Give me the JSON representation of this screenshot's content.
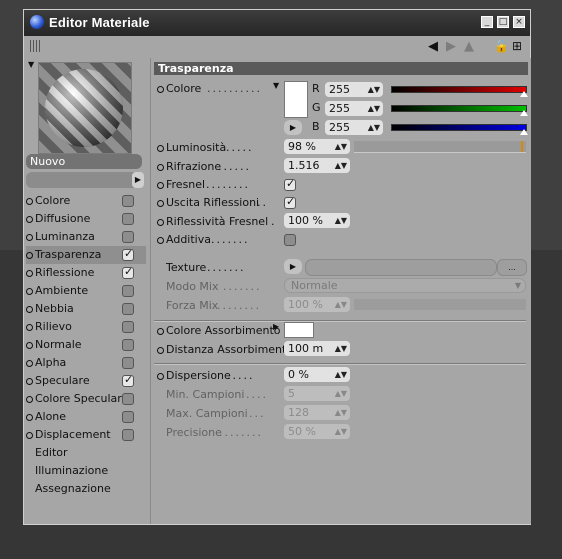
{
  "window": {
    "title": "Editor Materiale"
  },
  "preview": {
    "material_name": "Nuovo"
  },
  "channels": [
    {
      "label": "Colore",
      "checked": false
    },
    {
      "label": "Diffusione",
      "checked": false
    },
    {
      "label": "Luminanza",
      "checked": false
    },
    {
      "label": "Trasparenza",
      "checked": true
    },
    {
      "label": "Riflessione",
      "checked": true
    },
    {
      "label": "Ambiente",
      "checked": false
    },
    {
      "label": "Nebbia",
      "checked": false
    },
    {
      "label": "Rilievo",
      "checked": false
    },
    {
      "label": "Normale",
      "checked": false
    },
    {
      "label": "Alpha",
      "checked": false
    },
    {
      "label": "Speculare",
      "checked": true
    },
    {
      "label": "Colore Speculare",
      "checked": false
    },
    {
      "label": "Alone",
      "checked": false
    },
    {
      "label": "Displacement",
      "checked": false
    }
  ],
  "extra_pages": [
    "Editor",
    "Illuminazione",
    "Assegnazione"
  ],
  "section": {
    "title": "Trasparenza"
  },
  "color": {
    "label": "Colore",
    "r_label": "R",
    "g_label": "G",
    "b_label": "B",
    "r": "255",
    "g": "255",
    "b": "255",
    "swatch": "#ffffff"
  },
  "params": {
    "luminosita": {
      "label": "Luminosità",
      "value": "98 %",
      "fraction": 0.98
    },
    "rifrazione": {
      "label": "Rifrazione",
      "value": "1.516"
    },
    "fresnel": {
      "label": "Fresnel",
      "checked": true
    },
    "uscita_riflessioni": {
      "label": "Uscita Riflessioni",
      "checked": true
    },
    "riflessivita_fresnel": {
      "label": "Riflessività Fresnel",
      "value": "100 %"
    },
    "additiva": {
      "label": "Additiva",
      "checked": false
    },
    "texture": {
      "label": "Texture",
      "more": "..."
    },
    "modo_mix": {
      "label": "Modo Mix",
      "value": "Normale"
    },
    "forza_mix": {
      "label": "Forza Mix",
      "value": "100 %"
    },
    "colore_assorbimento": {
      "label": "Colore Assorbimento",
      "swatch": "#ffffff"
    },
    "distanza_assorbimento": {
      "label": "Distanza Assorbimento",
      "value": "100 m"
    },
    "dispersione": {
      "label": "Dispersione",
      "value": "0 %"
    },
    "min_campioni": {
      "label": "Min. Campioni",
      "value": "5"
    },
    "max_campioni": {
      "label": "Max. Campioni",
      "value": "128"
    },
    "precisione": {
      "label": "Precisione",
      "value": "50 %"
    }
  },
  "colors": {
    "accent_r": "#e00000",
    "accent_g": "#00c000",
    "accent_b": "#0000e0",
    "header": "#5a5a5a"
  }
}
